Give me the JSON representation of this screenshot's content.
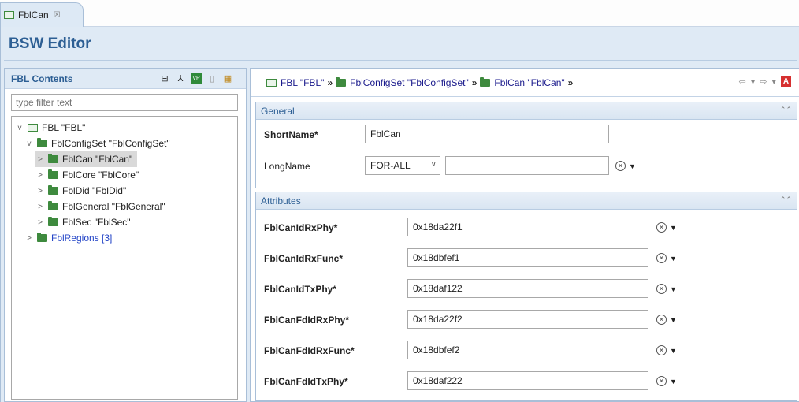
{
  "tab": {
    "label": "FblCan",
    "close": "☒"
  },
  "editor": {
    "title": "BSW Editor"
  },
  "left": {
    "title": "FBL Contents",
    "filter_placeholder": "type filter text",
    "tree": [
      {
        "label": "FBL \"FBL\"",
        "level": 0,
        "twist": "v",
        "icon": "module",
        "selected": false,
        "link": false
      },
      {
        "label": "FblConfigSet \"FblConfigSet\"",
        "level": 1,
        "twist": "v",
        "icon": "folder",
        "selected": false,
        "link": false
      },
      {
        "label": "FblCan \"FblCan\"",
        "level": 2,
        "twist": ">",
        "icon": "folder",
        "selected": true,
        "link": false
      },
      {
        "label": "FblCore \"FblCore\"",
        "level": 2,
        "twist": ">",
        "icon": "folder",
        "selected": false,
        "link": false
      },
      {
        "label": "FblDid \"FblDid\"",
        "level": 2,
        "twist": ">",
        "icon": "folder",
        "selected": false,
        "link": false
      },
      {
        "label": "FblGeneral \"FblGeneral\"",
        "level": 2,
        "twist": ">",
        "icon": "folder",
        "selected": false,
        "link": false
      },
      {
        "label": "FblSec \"FblSec\"",
        "level": 2,
        "twist": ">",
        "icon": "folder",
        "selected": false,
        "link": false
      },
      {
        "label": "FblRegions [3]",
        "level": 1,
        "twist": ">",
        "icon": "folder",
        "selected": false,
        "link": true
      }
    ]
  },
  "breadcrumb": {
    "items": [
      "FBL \"FBL\"",
      "FblConfigSet \"FblConfigSet\"",
      "FblCan \"FblCan\""
    ],
    "separator": "»"
  },
  "general": {
    "title": "General",
    "shortname_label": "ShortName*",
    "shortname_value": "FblCan",
    "longname_label": "LongName",
    "longname_lang": "FOR-ALL",
    "longname_value": ""
  },
  "attributes": {
    "title": "Attributes",
    "rows": [
      {
        "label": "FblCanIdRxPhy*",
        "value": "0x18da22f1"
      },
      {
        "label": "FblCanIdRxFunc*",
        "value": "0x18dbfef1"
      },
      {
        "label": "FblCanIdTxPhy*",
        "value": "0x18daf122"
      },
      {
        "label": "FblCanFdIdRxPhy*",
        "value": "0x18da22f2"
      },
      {
        "label": "FblCanFdIdRxFunc*",
        "value": "0x18dbfef2"
      },
      {
        "label": "FblCanFdIdTxPhy*",
        "value": "0x18daf222"
      }
    ]
  },
  "colors": {
    "accent": "#2d5f94",
    "link": "#2445c7",
    "folder": "#3e8a3e"
  }
}
